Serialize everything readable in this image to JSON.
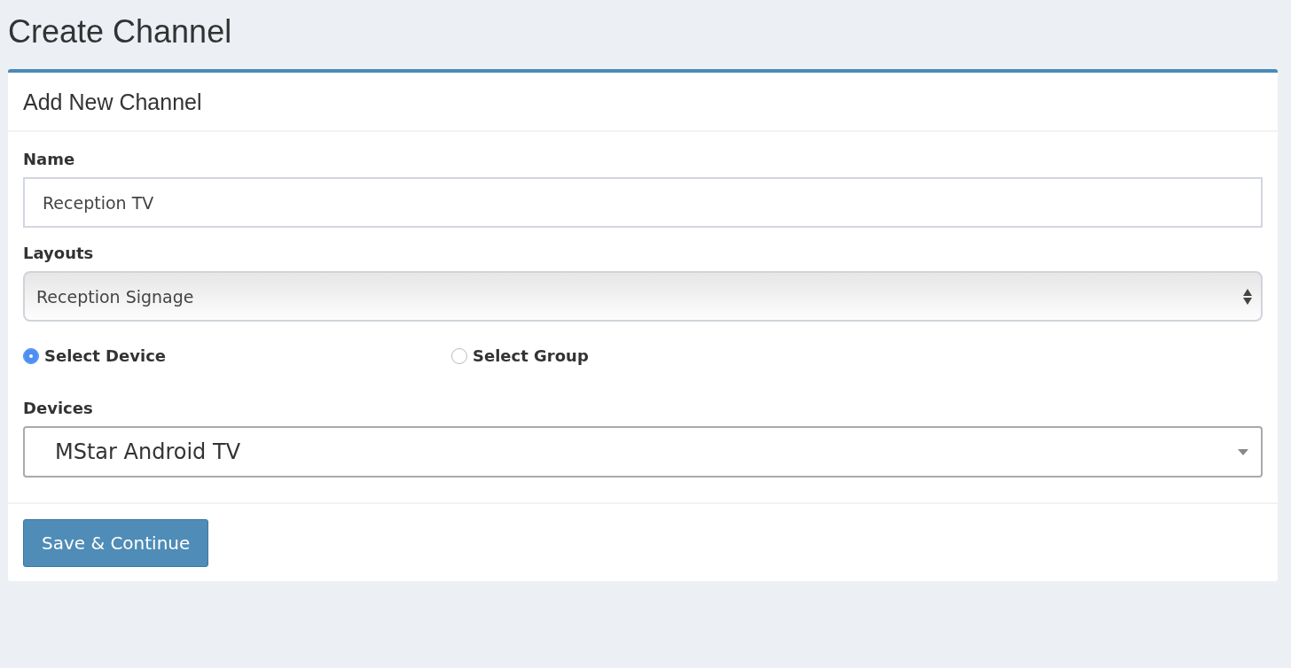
{
  "page_title": "Create Channel",
  "card": {
    "title": "Add New Channel",
    "fields": [
      {
        "kind": "text",
        "label": "Name",
        "value": "Reception TV"
      },
      {
        "kind": "native-select",
        "label": "Layouts",
        "value": "Reception Signage"
      },
      {
        "kind": "radio",
        "options": [
          {
            "label": "Select Device",
            "selected": true
          },
          {
            "label": "Select Group",
            "selected": false
          }
        ]
      },
      {
        "kind": "select",
        "label": "Devices",
        "value": "MStar Android TV"
      }
    ],
    "buttons": [
      {
        "label": "Save & Continue"
      }
    ]
  }
}
